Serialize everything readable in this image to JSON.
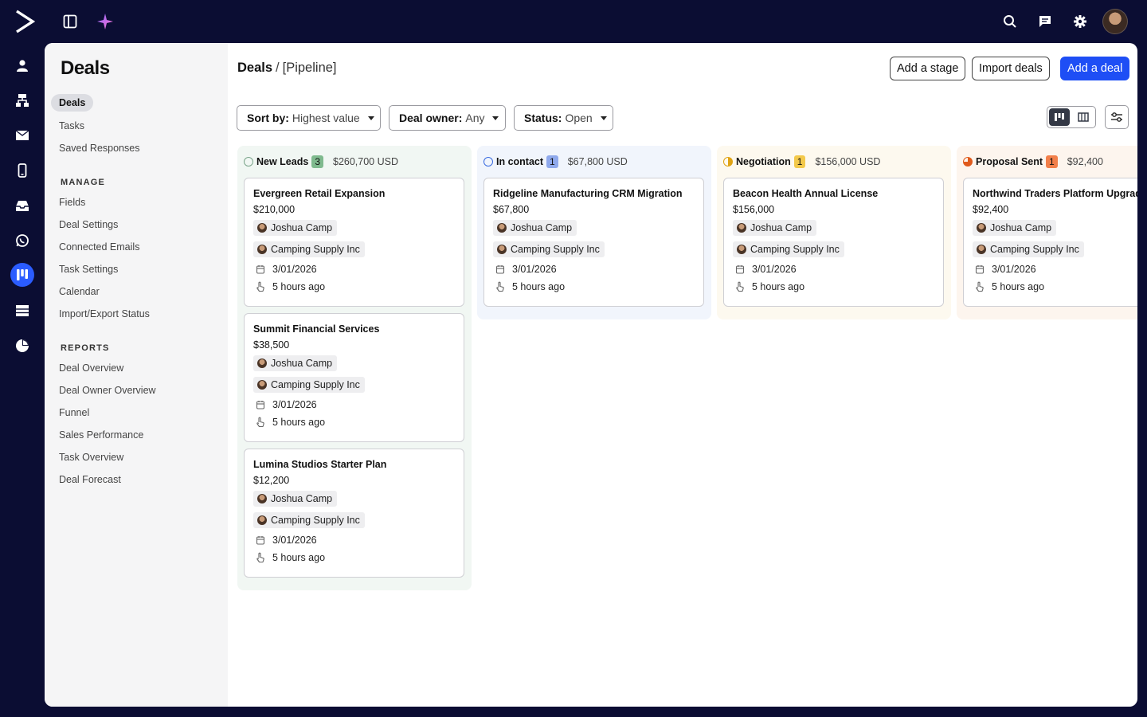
{
  "topbar": {
    "icons": [
      "logo-icon",
      "sidebar-toggle-icon",
      "sparkle-icon",
      "search-icon",
      "chat-icon",
      "gear-icon"
    ]
  },
  "rail": {
    "icons": [
      "contacts-icon",
      "org-chart-icon",
      "mail-icon",
      "mobile-icon",
      "inbox-icon",
      "whatsapp-icon",
      "deals-icon",
      "table-icon",
      "pie-chart-icon"
    ]
  },
  "subnav": {
    "title": "Deals",
    "items": [
      "Deals",
      "Tasks",
      "Saved Responses"
    ],
    "manage_heading": "MANAGE",
    "manage_items": [
      "Fields",
      "Deal Settings",
      "Connected Emails",
      "Task Settings",
      "Calendar",
      "Import/Export Status"
    ],
    "reports_heading": "REPORTS",
    "reports_items": [
      "Deal Overview",
      "Deal Owner Overview",
      "Funnel",
      "Sales Performance",
      "Task Overview",
      "Deal Forecast"
    ]
  },
  "header": {
    "crumb_root": "Deals",
    "crumb_sep": "/",
    "crumb_page": "[Pipeline]",
    "add_stage": "Add a stage",
    "import_deals": "Import deals",
    "add_deal": "Add a deal"
  },
  "filters": {
    "sort_label": "Sort by:",
    "sort_value": "Highest value",
    "owner_label": "Deal owner:",
    "owner_value": "Any",
    "status_label": "Status:",
    "status_value": "Open"
  },
  "columns": [
    {
      "name": "New Leads",
      "count": "3",
      "amount": "$260,700 USD",
      "bg": "#f1f7f3",
      "count_bg": "#7fba8e",
      "ring": "#7aa58a",
      "cards": [
        {
          "title": "Evergreen Retail Expansion",
          "value": "$210,000",
          "owner": "Joshua Camp",
          "company": "Camping Supply Inc",
          "date": "3/01/2026",
          "activity": "5 hours ago"
        },
        {
          "title": "Summit Financial Services",
          "value": "$38,500",
          "owner": "Joshua Camp",
          "company": "Camping Supply Inc",
          "date": "3/01/2026",
          "activity": "5 hours ago"
        },
        {
          "title": "Lumina Studios Starter Plan",
          "value": "$12,200",
          "owner": "Joshua Camp",
          "company": "Camping Supply Inc",
          "date": "3/01/2026",
          "activity": "5 hours ago"
        }
      ]
    },
    {
      "name": "In contact",
      "count": "1",
      "amount": "$67,800 USD",
      "bg": "#f1f5fc",
      "count_bg": "#8fa9ec",
      "ring": "#3a6be0",
      "cards": [
        {
          "title": "Ridgeline Manufacturing CRM Migration",
          "value": "$67,800",
          "owner": "Joshua Camp",
          "company": "Camping Supply Inc",
          "date": "3/01/2026",
          "activity": "5 hours ago"
        }
      ]
    },
    {
      "name": "Negotiation",
      "count": "1",
      "amount": "$156,000 USD",
      "bg": "#fdf9ef",
      "count_bg": "#f3c94b",
      "ring": "#e0a313",
      "cards": [
        {
          "title": "Beacon Health Annual License",
          "value": "$156,000",
          "owner": "Joshua Camp",
          "company": "Camping Supply Inc",
          "date": "3/01/2026",
          "activity": "5 hours ago"
        }
      ]
    },
    {
      "name": "Proposal Sent",
      "count": "1",
      "amount": "$92,400",
      "bg": "#fdf5ee",
      "count_bg": "#f27f4a",
      "ring": "#e05a1c",
      "cards": [
        {
          "title": "Northwind Traders Platform Upgrade",
          "value": "$92,400",
          "owner": "Joshua Camp",
          "company": "Camping Supply Inc",
          "date": "3/01/2026",
          "activity": "5 hours ago"
        }
      ]
    }
  ]
}
